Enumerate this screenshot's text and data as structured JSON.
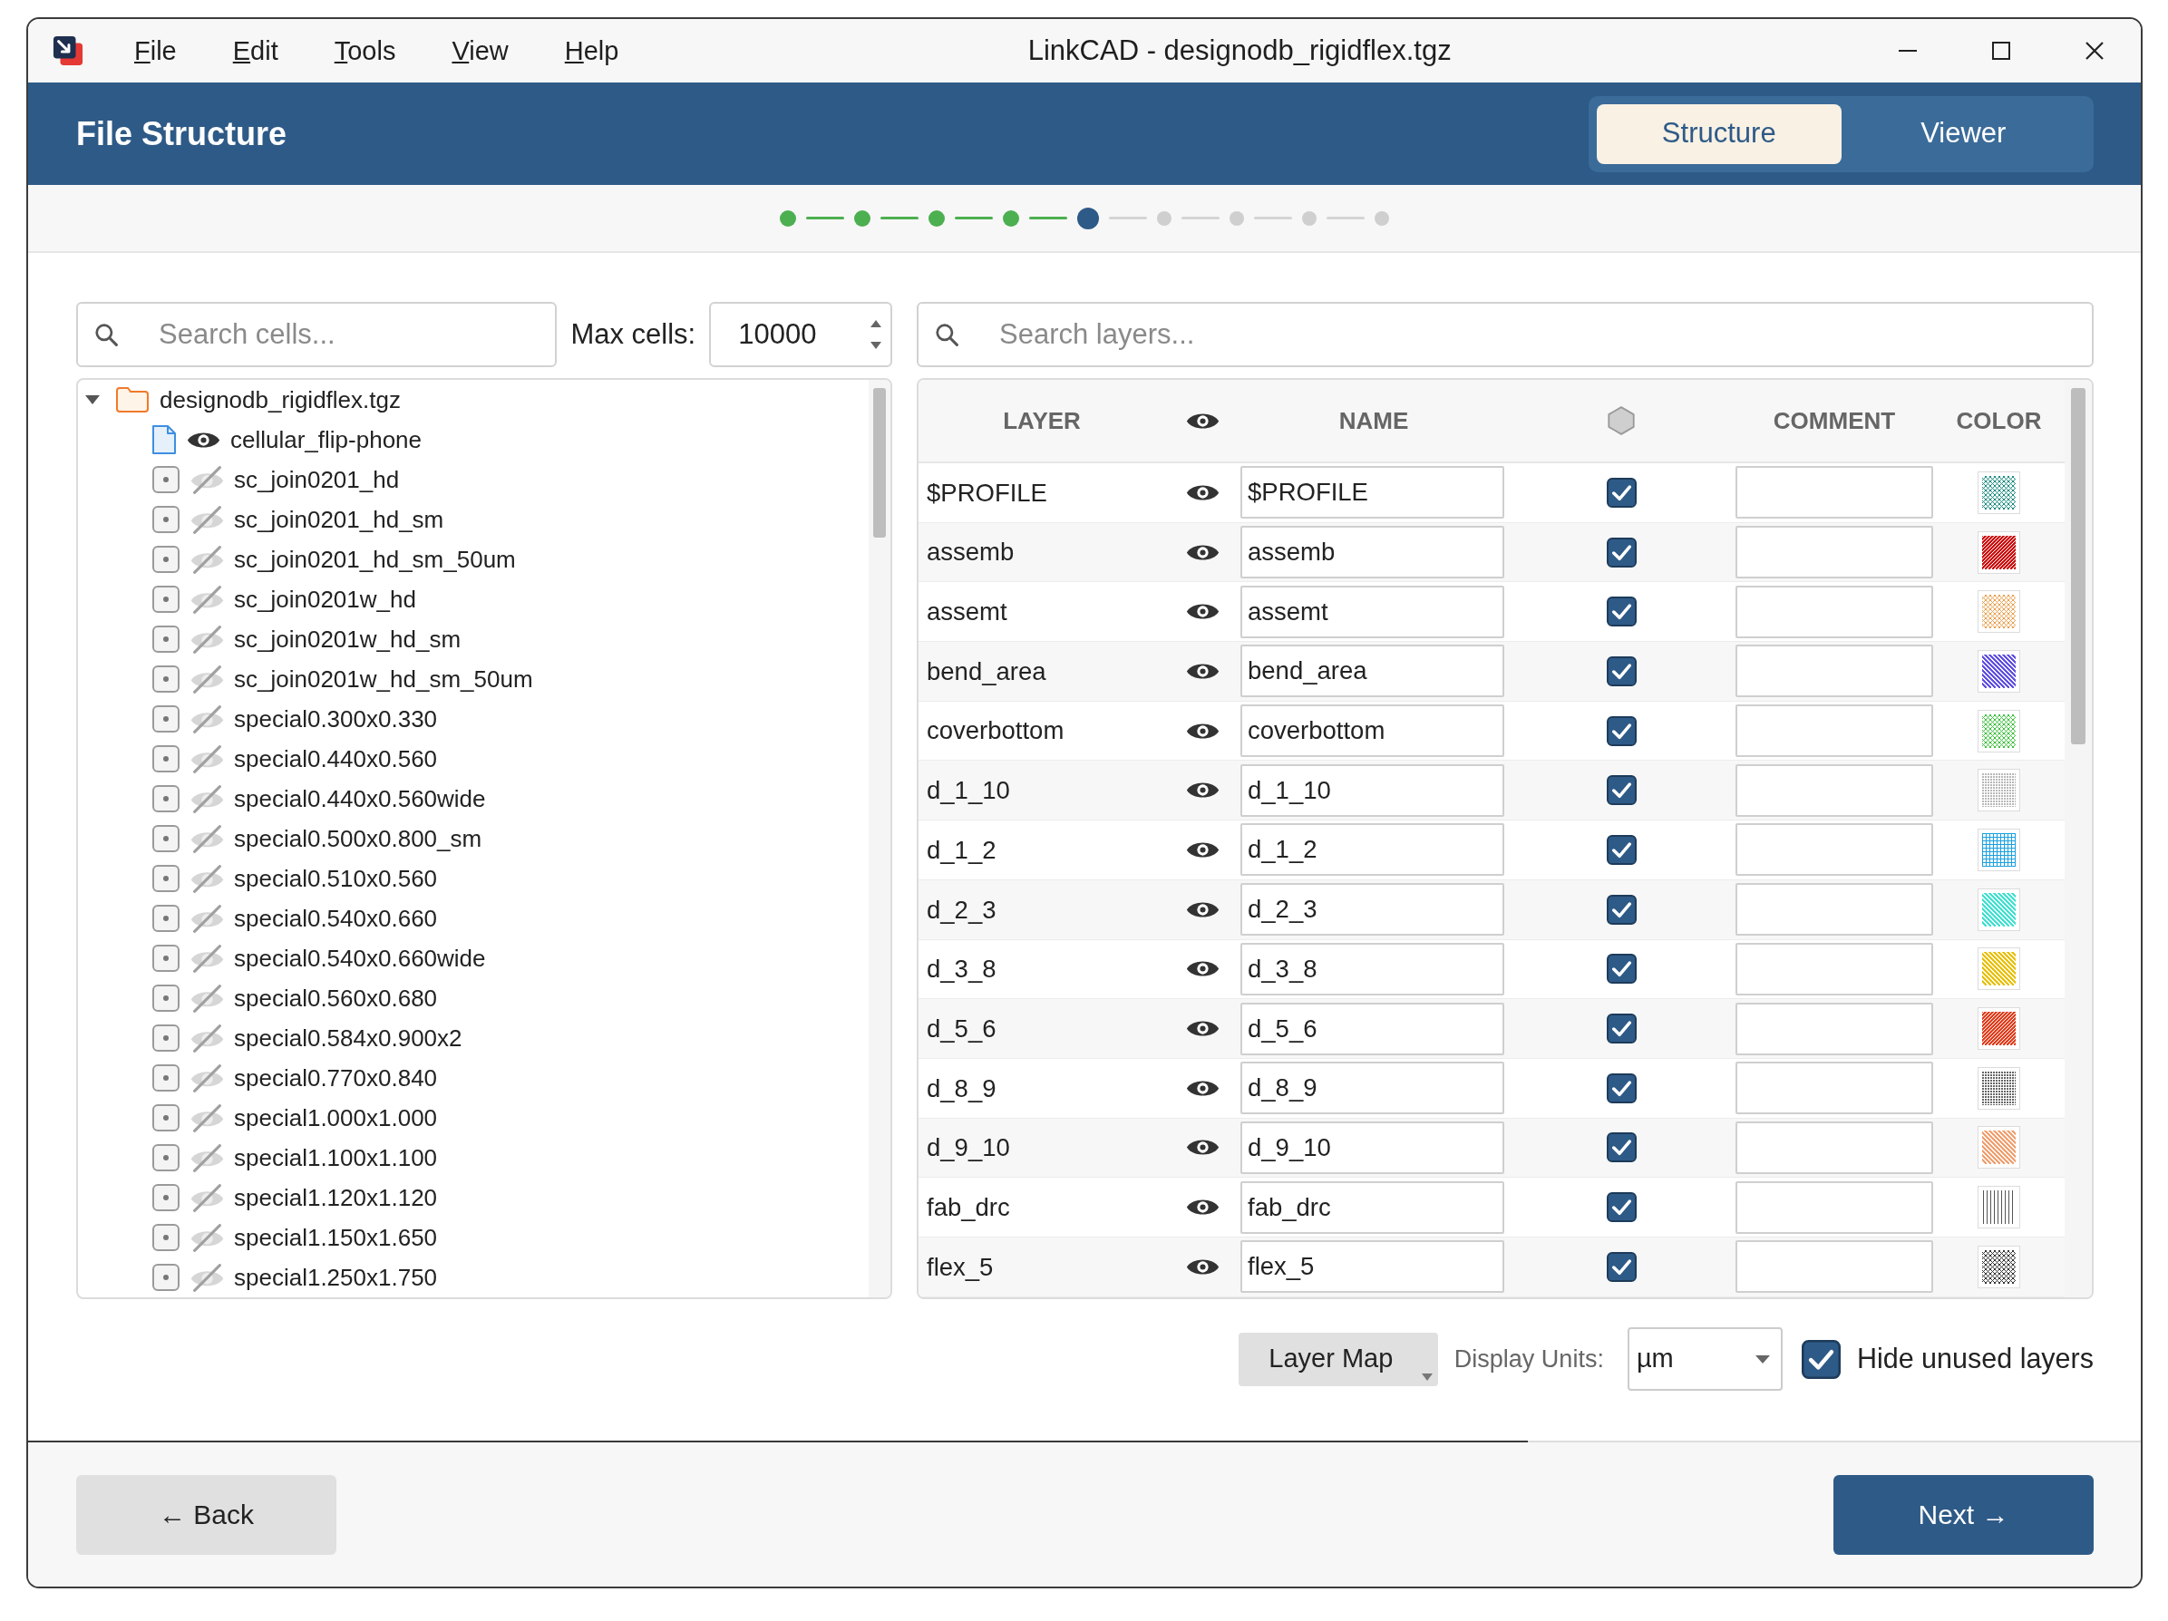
{
  "window": {
    "title": "LinkCAD - designodb_rigidflex.tgz"
  },
  "menu": [
    "File",
    "Edit",
    "Tools",
    "View",
    "Help"
  ],
  "header": {
    "title": "File Structure",
    "tabs": [
      {
        "label": "Structure",
        "selected": true
      },
      {
        "label": "Viewer",
        "selected": false
      }
    ]
  },
  "steps": [
    {
      "done": true,
      "selected": false
    },
    {
      "done": true,
      "selected": false
    },
    {
      "done": true,
      "selected": false
    },
    {
      "done": true,
      "selected": false
    },
    {
      "done": false,
      "selected": true
    },
    {
      "done": false,
      "selected": false
    },
    {
      "done": false,
      "selected": false
    },
    {
      "done": false,
      "selected": false
    },
    {
      "done": false,
      "selected": false
    }
  ],
  "cell_panel": {
    "search": {
      "placeholder": "Search cells..."
    },
    "max_cells": {
      "label": "Max cells:",
      "value": "10000"
    },
    "tree": {
      "label": "designodb_rigidflex.tgz",
      "kind": "folder",
      "expanded": true,
      "children": [
        {
          "label": "cellular_flip-phone",
          "kind": "file",
          "visible": true
        },
        {
          "label": "sc_join0201_hd",
          "kind": "cell",
          "visible": false
        },
        {
          "label": "sc_join0201_hd_sm",
          "kind": "cell",
          "visible": false
        },
        {
          "label": "sc_join0201_hd_sm_50um",
          "kind": "cell",
          "visible": false
        },
        {
          "label": "sc_join0201w_hd",
          "kind": "cell",
          "visible": false
        },
        {
          "label": "sc_join0201w_hd_sm",
          "kind": "cell",
          "visible": false
        },
        {
          "label": "sc_join0201w_hd_sm_50um",
          "kind": "cell",
          "visible": false
        },
        {
          "label": "special0.300x0.330",
          "kind": "cell",
          "visible": false
        },
        {
          "label": "special0.440x0.560",
          "kind": "cell",
          "visible": false
        },
        {
          "label": "special0.440x0.560wide",
          "kind": "cell",
          "visible": false
        },
        {
          "label": "special0.500x0.800_sm",
          "kind": "cell",
          "visible": false
        },
        {
          "label": "special0.510x0.560",
          "kind": "cell",
          "visible": false
        },
        {
          "label": "special0.540x0.660",
          "kind": "cell",
          "visible": false
        },
        {
          "label": "special0.540x0.660wide",
          "kind": "cell",
          "visible": false
        },
        {
          "label": "special0.560x0.680",
          "kind": "cell",
          "visible": false
        },
        {
          "label": "special0.584x0.900x2",
          "kind": "cell",
          "visible": false
        },
        {
          "label": "special0.770x0.840",
          "kind": "cell",
          "visible": false
        },
        {
          "label": "special1.000x1.000",
          "kind": "cell",
          "visible": false
        },
        {
          "label": "special1.100x1.100",
          "kind": "cell",
          "visible": false
        },
        {
          "label": "special1.120x1.120",
          "kind": "cell",
          "visible": false
        },
        {
          "label": "special1.150x1.650",
          "kind": "cell",
          "visible": false
        },
        {
          "label": "special1.250x1.750",
          "kind": "cell",
          "visible": false
        }
      ]
    }
  },
  "layer_panel": {
    "search": {
      "placeholder": "Search layers..."
    },
    "columns": [
      {
        "kind": "text",
        "label": "LAYER"
      },
      {
        "kind": "eye"
      },
      {
        "kind": "text",
        "label": "NAME"
      },
      {
        "kind": "hexagon"
      },
      {
        "kind": "text",
        "label": "COMMENT"
      },
      {
        "kind": "text",
        "label": "COLOR"
      }
    ],
    "rows": [
      {
        "layer": "$PROFILE",
        "visible": true,
        "name": "$PROFILE",
        "checked": true,
        "color": "#1a8a80",
        "kind": "crosshatch"
      },
      {
        "layer": "assemb",
        "visible": true,
        "name": "assemb",
        "checked": true,
        "color": "#cc1111",
        "kind": "forward"
      },
      {
        "layer": "assemt",
        "visible": true,
        "name": "assemt",
        "checked": true,
        "color": "#e8a050",
        "kind": "crosshatch"
      },
      {
        "layer": "bend_area",
        "visible": true,
        "name": "bend_area",
        "checked": true,
        "color": "#6050e0",
        "kind": "backward"
      },
      {
        "layer": "coverbottom",
        "visible": true,
        "name": "coverbottom",
        "checked": true,
        "color": "#40c040",
        "kind": "crosshatch"
      },
      {
        "layer": "d_1_10",
        "visible": true,
        "name": "d_1_10",
        "checked": true,
        "color": "#b8b8b8",
        "kind": "dots"
      },
      {
        "layer": "d_1_2",
        "visible": true,
        "name": "d_1_2",
        "checked": true,
        "color": "#1aa0e0",
        "kind": "grid"
      },
      {
        "layer": "d_2_3",
        "visible": true,
        "name": "d_2_3",
        "checked": true,
        "color": "#40e0d0",
        "kind": "backward"
      },
      {
        "layer": "d_3_8",
        "visible": true,
        "name": "d_3_8",
        "checked": true,
        "color": "#e8c000",
        "kind": "backward"
      },
      {
        "layer": "d_5_6",
        "visible": true,
        "name": "d_5_6",
        "checked": true,
        "color": "#e04020",
        "kind": "forward"
      },
      {
        "layer": "d_8_9",
        "visible": true,
        "name": "d_8_9",
        "checked": true,
        "color": "#666666",
        "kind": "dots"
      },
      {
        "layer": "d_9_10",
        "visible": true,
        "name": "d_9_10",
        "checked": true,
        "color": "#f0a070",
        "kind": "backward"
      },
      {
        "layer": "fab_drc",
        "visible": true,
        "name": "fab_drc",
        "checked": true,
        "color": "#555555",
        "kind": "vertical"
      },
      {
        "layer": "flex_5",
        "visible": true,
        "name": "flex_5",
        "checked": true,
        "color": "#333333",
        "kind": "crosshatch"
      }
    ]
  },
  "options": {
    "layer_map": {
      "label": "Layer Map"
    },
    "display_units": {
      "label": "Display Units:",
      "value": "µm"
    },
    "hide_unused": {
      "label": "Hide unused layers",
      "checked": true
    }
  },
  "footer": {
    "progress": {
      "level": 0.71
    },
    "back": {
      "label": "← Back"
    },
    "next": {
      "label": "Next →"
    }
  }
}
